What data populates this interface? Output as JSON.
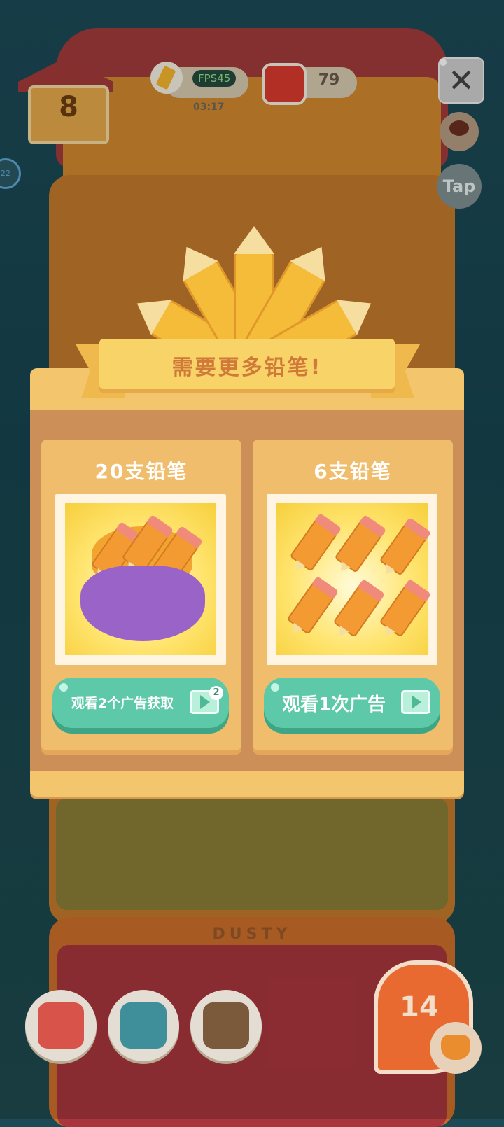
{
  "hud": {
    "house_level": "8",
    "fps": "FPS45",
    "timer": "03:17",
    "can_count": "79",
    "tap_label": "Tap",
    "side_tab_label": "22"
  },
  "background": {
    "floor_sign": "DUSTY"
  },
  "dialog": {
    "title": "需要更多铅笔!",
    "offers": [
      {
        "title": "20支铅笔",
        "button_label": "观看2个广告获取",
        "badge": "2"
      },
      {
        "title": "6支铅笔",
        "button_label": "观看1次广告"
      }
    ]
  },
  "bottom": {
    "level_badge": "14"
  },
  "colors": {
    "accent_green": "#5ec9a8",
    "dialog_bg": "#f3c66e",
    "ribbon": "#f8d368",
    "title_text": "#d07a3a"
  }
}
